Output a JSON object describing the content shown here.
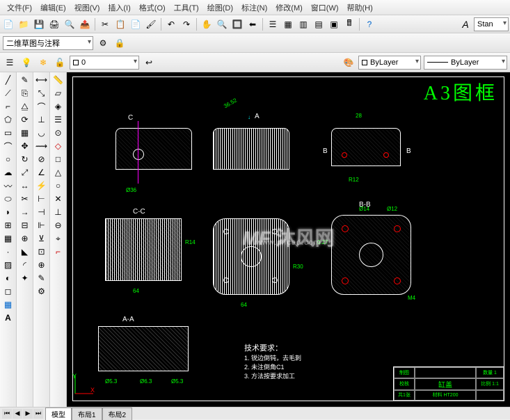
{
  "menu": {
    "file": "文件(F)",
    "edit": "编辑(E)",
    "view": "视图(V)",
    "insert": "插入(I)",
    "format": "格式(O)",
    "tools": "工具(T)",
    "draw": "绘图(D)",
    "dimension": "标注(N)",
    "modify": "修改(M)",
    "window": "窗口(W)",
    "help": "帮助(H)"
  },
  "toolbar2": {
    "workspace": "二维草图与注释"
  },
  "toolbar3": {
    "layer_label": "0",
    "bylayer1": "ByLayer",
    "bylayer2": "ByLayer",
    "style": "Stan"
  },
  "canvas": {
    "title": "A3图框",
    "watermark": "沐风网",
    "watermark_url": "www.mfcad.com",
    "tech_req_title": "技术要求：",
    "tech_req_1": "1. 锐边倒钝，去毛刺",
    "tech_req_2": "2. 未注倒角C1",
    "tech_req_3": "3. 方法按要求加工",
    "sections": {
      "aa": "A-A",
      "bb": "B-B",
      "cc": "C-C",
      "a": "A",
      "b": "B",
      "c": "C"
    },
    "dims": {
      "d36": "Ø36",
      "d64a": "64",
      "d64b": "64",
      "d14": "Ø14",
      "d12": "Ø12",
      "d5_3a": "Ø5.3",
      "d5_3b": "Ø5.3",
      "d6_3": "Ø6.3",
      "r14": "R14",
      "r30": "R30",
      "d28": "28",
      "r12": "R12",
      "d0_27": "0.27",
      "m4": "M4",
      "d36_52": "36.52"
    },
    "titleblock": {
      "tubiao": "制图",
      "shenyue": "校核",
      "r1c2": "",
      "r2c2": "",
      "part": "缸盖",
      "bilie": "比例 1:1",
      "zhongliang": "数量 1",
      "cailiao": "材料",
      "ht200": "HT200",
      "gongyi": "共1张"
    }
  },
  "tabs": {
    "model": "模型",
    "layout1": "布局1",
    "layout2": "布局2"
  }
}
